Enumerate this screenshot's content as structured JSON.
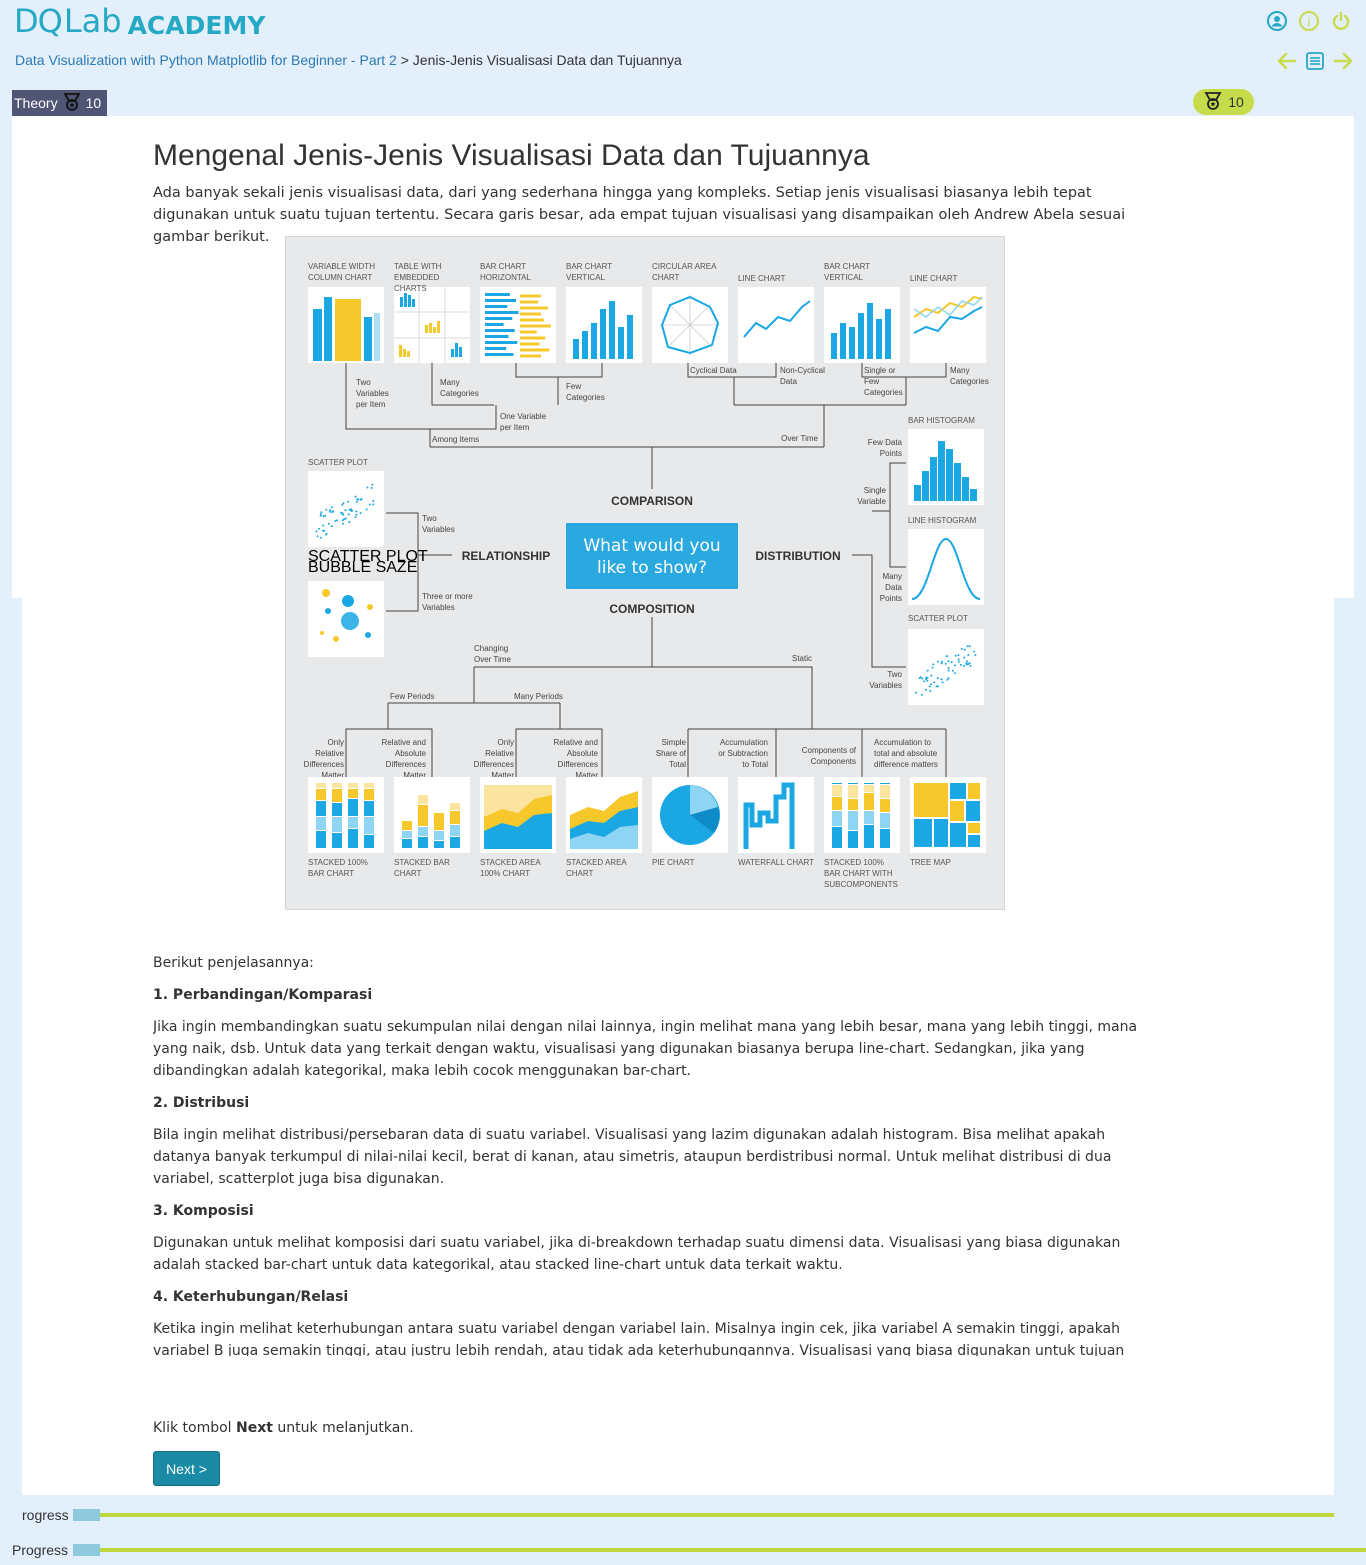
{
  "brand": {
    "logo_dq": "DQ",
    "logo_lab": "Lab",
    "logo_academy": "ACADEMY"
  },
  "breadcrumb": {
    "course": "Data Visualization with Python Matplotlib for Beginner - Part 2",
    "separator": ">",
    "current": "Jenis-Jenis Visualisasi Data dan Tujuannya"
  },
  "tab": {
    "label": "Theory",
    "points": "10"
  },
  "points_badge": "10",
  "content": {
    "title": "Mengenal Jenis-Jenis Visualisasi Data dan Tujuannya",
    "intro": "Ada banyak sekali jenis visualisasi data, dari yang sederhana hingga yang kompleks. Setiap jenis visualisasi biasanya lebih tepat digunakan untuk suatu tujuan tertentu. Secara garis besar, ada empat tujuan visualisasi yang disampaikan oleh Andrew Abela sesuai gambar berikut."
  },
  "figure": {
    "center": "What would you like to show?",
    "categories": {
      "comparison": "COMPARISON",
      "relationship": "RELATIONSHIP",
      "distribution": "DISTRIBUTION",
      "composition": "COMPOSITION"
    },
    "top_charts": [
      "VARIABLE WIDTH COLUMN CHART",
      "TABLE WITH EMBEDDED CHARTS",
      "BAR CHART HORIZONTAL",
      "BAR CHART VERTICAL",
      "CIRCULAR AREA CHART",
      "LINE CHART",
      "BAR CHART VERTICAL",
      "LINE CHART"
    ],
    "top_labels": [
      "Two Variables per Item",
      "Many Categories",
      "Few Categories",
      "One Variable per Item",
      "Cyclical Data",
      "Non-Cyclical Data",
      "Single or Few Categories",
      "Many Categories",
      "Among Items",
      "Over Time"
    ],
    "left_charts": [
      "SCATTER PLOT",
      "SCATTER PLOT BUBBLE SAZE"
    ],
    "left_labels": [
      "Two Variables",
      "Three or more Variables"
    ],
    "right_charts": [
      "BAR HISTOGRAM",
      "LINE HISTOGRAM",
      "SCATTER PLOT"
    ],
    "right_labels": [
      "Few Data Points",
      "Single Variable",
      "Many Data Points",
      "Two Variables"
    ],
    "bottom_labels": [
      "Changing Over Time",
      "Static",
      "Few Periods",
      "Many Periods",
      "Only Relative Differences Matter",
      "Relative and Absolute Differences Matter",
      "Only Relative Differences Matter",
      "Relative and Absolute Differences Matter",
      "Simple Share of Total",
      "Accumulation or Subtraction to Total",
      "Components of Components",
      "Accumulation to total and absolute difference matters"
    ],
    "bottom_charts": [
      "STACKED 100% BAR CHART",
      "STACKED BAR CHART",
      "STACKED AREA 100% CHART",
      "STACKED AREA CHART",
      "PIE CHART",
      "WATERFALL CHART",
      "STACKED 100% BAR CHART WITH SUBCOMPONENTS",
      "TREE MAP"
    ]
  },
  "body": {
    "lead": "Berikut penjelasannya:",
    "sections": [
      {
        "heading": "1. Perbandingan/Komparasi",
        "text": "Jika ingin membandingkan suatu sekumpulan nilai dengan nilai lainnya, ingin melihat mana yang lebih besar, mana yang lebih tinggi, mana yang naik, dsb. Untuk data yang terkait dengan waktu, visualisasi yang digunakan biasanya berupa line-chart. Sedangkan, jika yang dibandingkan adalah kategorikal, maka lebih cocok menggunakan bar-chart."
      },
      {
        "heading": "2. Distribusi",
        "text": "Bila ingin melihat distribusi/persebaran data di suatu variabel. Visualisasi yang lazim digunakan adalah histogram. Bisa melihat apakah datanya banyak terkumpul di nilai-nilai kecil, berat di kanan, atau simetris, ataupun berdistribusi normal. Untuk melihat distribusi di dua variabel, scatterplot juga bisa digunakan."
      },
      {
        "heading": "3. Komposisi",
        "text": "Digunakan untuk melihat komposisi dari suatu variabel, jika di-breakdown terhadap suatu dimensi data. Visualisasi yang biasa digunakan adalah stacked bar-chart untuk data kategorikal, atau stacked line-chart untuk data terkait waktu."
      },
      {
        "heading": "4. Keterhubungan/Relasi",
        "text": "Ketika ingin melihat keterhubungan antara suatu variabel dengan variabel lain. Misalnya ingin cek, jika variabel A semakin tinggi, apakah variabel B juga semakin tinggi, atau justru lebih rendah, atau tidak ada keterhubungannya. Visualisasi yang biasa digunakan untuk tujuan ini adalah scatter-"
      }
    ]
  },
  "footer": {
    "instruction_pre": "Klik tombol ",
    "instruction_bold": "Next",
    "instruction_post": " untuk melanjutkan.",
    "next_label": "Next >",
    "progress_label_1": "rogress",
    "progress_label_2": "Progress"
  },
  "colors": {
    "accent": "#26a9c4",
    "lime": "#c6dc4b",
    "tab": "#4f5574",
    "button": "#1a8aa5",
    "link": "#2d7ab5",
    "chart_blue": "#1aa7e4",
    "chart_yellow": "#f7c82c"
  },
  "icons": [
    "user-icon",
    "info-icon",
    "power-icon",
    "arrow-left-icon",
    "list-icon",
    "arrow-right-icon",
    "medal-icon"
  ]
}
